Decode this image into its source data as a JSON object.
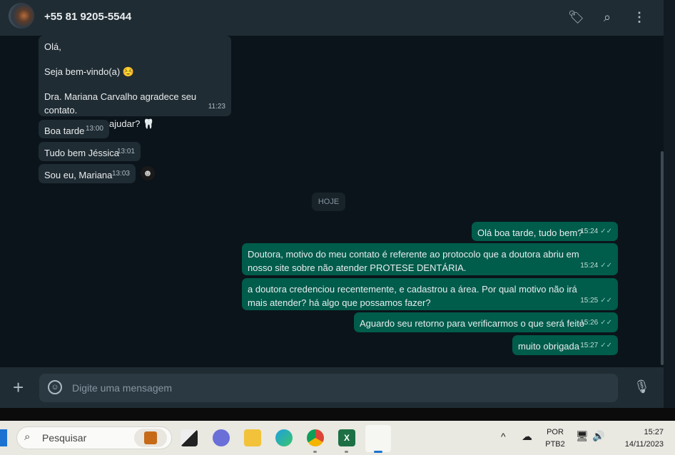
{
  "header": {
    "contact": "+55 81 9205-5544",
    "icons": [
      "label-icon",
      "search-icon",
      "more-vertical-icon"
    ]
  },
  "messages": [
    {
      "dir": "in",
      "lines": [
        "Olá,",
        "",
        "Seja bem-vindo(a) ☺️",
        "",
        "Dra. Mariana Carvalho agradece seu contato.",
        "Como posso te ajudar? 🦷"
      ],
      "time": "11:23"
    },
    {
      "dir": "in",
      "text": "Boa tarde",
      "time": "13:00"
    },
    {
      "dir": "in",
      "text": "Tudo bem Jéssica",
      "time": "13:01"
    },
    {
      "dir": "in",
      "text": "Sou eu, Mariana",
      "time": "13:03"
    },
    {
      "dir": "out",
      "text": "Olá boa tarde, tudo bem?",
      "time": "15:24"
    },
    {
      "dir": "out",
      "text": "Doutora, motivo do meu contato é referente ao protocolo que a doutora abriu em nosso site sobre não atender PROTESE DENTÁRIA.",
      "time": "15:24"
    },
    {
      "dir": "out",
      "text": "a doutora credenciou recentemente, e cadastrou a área. Por qual motivo não irá mais atender? há algo que possamos fazer?",
      "time": "15:25"
    },
    {
      "dir": "out",
      "text": "Aguardo seu retorno para verificarmos o que será feito",
      "time": "15:26"
    },
    {
      "dir": "out",
      "text": "muito obrigada",
      "time": "15:27"
    }
  ],
  "date_divider": "HOJE",
  "composer": {
    "placeholder": "Digite uma mensagem"
  },
  "taskbar": {
    "search": "Pesquisar",
    "lang1": "POR",
    "lang2": "PTB2",
    "time": "15:27",
    "date": "14/11/2023"
  },
  "colors": {
    "incoming": "#202c33",
    "outgoing": "#005c4b",
    "background": "#0b141a"
  }
}
